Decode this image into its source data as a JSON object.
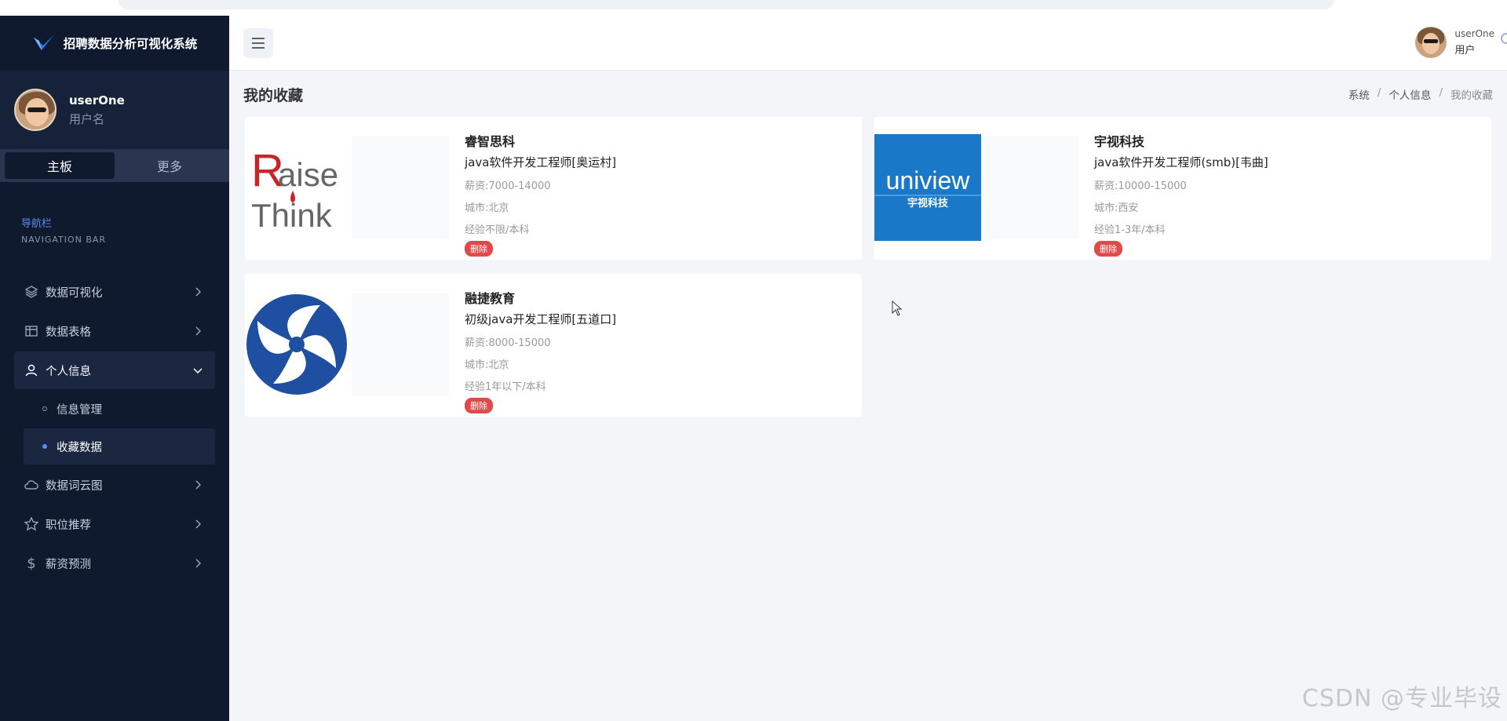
{
  "app": {
    "title": "招聘数据分析可视化系统"
  },
  "sidebar": {
    "user": {
      "name": "userOne",
      "role": "用户名"
    },
    "tabs": [
      {
        "label": "主板",
        "active": true
      },
      {
        "label": "更多",
        "active": false
      }
    ],
    "nav_header": {
      "cn": "导航栏",
      "en": "NAVIGATION BAR"
    },
    "menu": [
      {
        "label": "数据可视化",
        "icon": "layers-icon"
      },
      {
        "label": "数据表格",
        "icon": "table-icon"
      },
      {
        "label": "个人信息",
        "icon": "user-icon",
        "open": true,
        "children": [
          {
            "label": "信息管理"
          },
          {
            "label": "收藏数据",
            "active": true
          }
        ]
      },
      {
        "label": "数据词云图",
        "icon": "cloud-icon"
      },
      {
        "label": "职位推荐",
        "icon": "star-icon"
      },
      {
        "label": "薪资预测",
        "icon": "dollar-icon"
      }
    ]
  },
  "topbar": {
    "user": {
      "name": "userOne",
      "role": "用户"
    }
  },
  "page": {
    "title": "我的收藏",
    "breadcrumb": [
      "系统",
      "个人信息",
      "我的收藏"
    ]
  },
  "favorites": [
    {
      "company": "睿智思科",
      "job": "java软件开发工程师[奥运村]",
      "salary": "薪资:7000-14000",
      "city": "城市:北京",
      "experience": "经验不限/本科",
      "delete_label": "删除",
      "logo": "raisethink-logo",
      "logo_text": [
        "R",
        "aise",
        "Think"
      ]
    },
    {
      "company": "宇视科技",
      "job": "java软件开发工程师(smb)[韦曲]",
      "salary": "薪资:10000-15000",
      "city": "城市:西安",
      "experience": "经验1-3年/本科",
      "delete_label": "删除",
      "logo": "uniview-logo",
      "logo_text": [
        "uniview",
        "宇视科技"
      ]
    },
    {
      "company": "融捷教育",
      "job": "初级java开发工程师[五道口]",
      "salary": "薪资:8000-15000",
      "city": "城市:北京",
      "experience": "经验1年以下/本科",
      "delete_label": "删除",
      "logo": "rongjie-logo"
    }
  ],
  "watermark": "CSDN @专业毕设",
  "colors": {
    "sidebar_bg": "#0f1a2e",
    "accent": "#5a8df5",
    "danger": "#e04a4a",
    "uniview_blue": "#1a78c8",
    "rongjie_blue": "#1e4fa0"
  }
}
